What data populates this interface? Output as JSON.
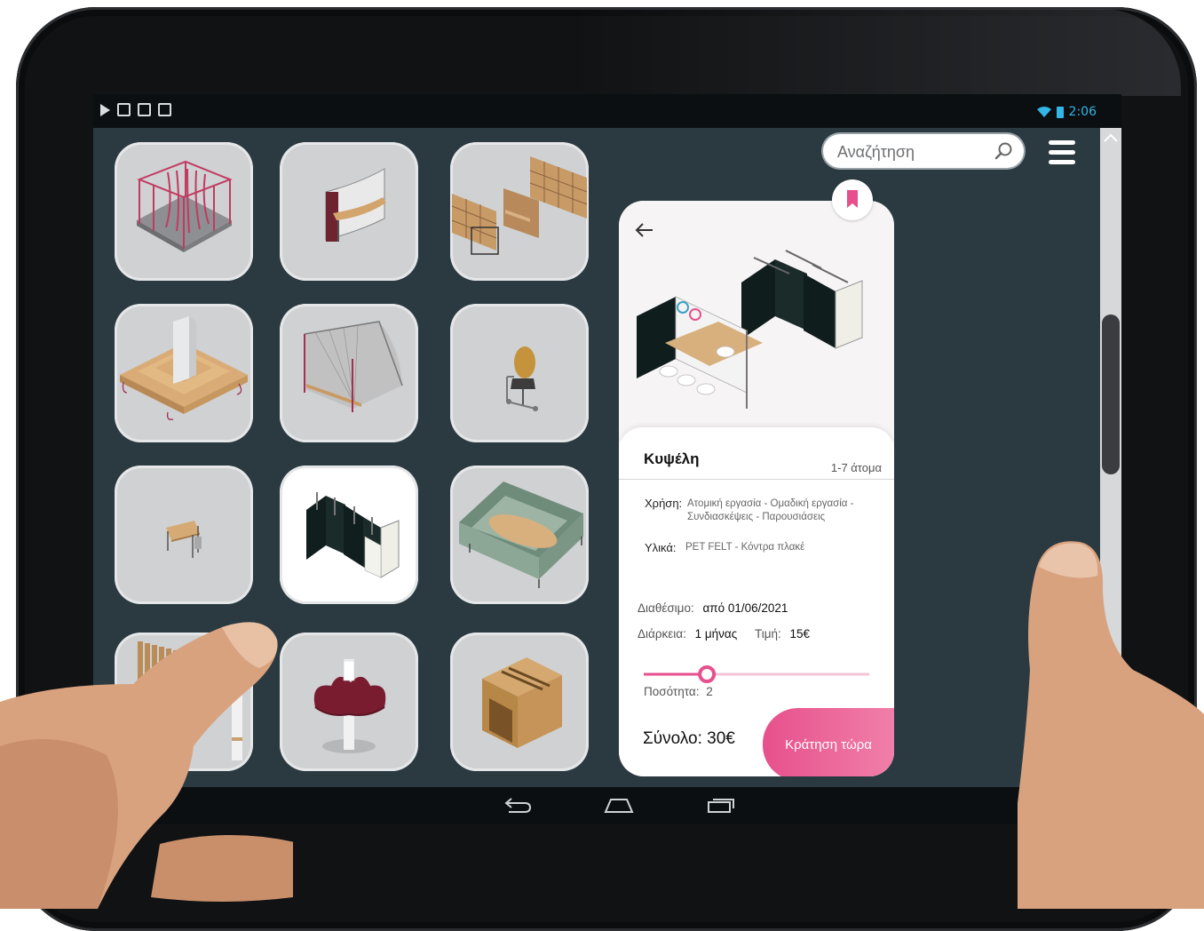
{
  "statusbar": {
    "time": "2:06"
  },
  "search": {
    "placeholder": "Αναζήτηση"
  },
  "colors": {
    "background": "#2a3a40",
    "accent": "#e7508c",
    "tile": "#cfd1d3"
  },
  "products": [
    {
      "icon": "canopy-pavilion-icon"
    },
    {
      "icon": "curved-desk-icon"
    },
    {
      "icon": "shelving-workspace-icon"
    },
    {
      "icon": "tiered-platform-icon"
    },
    {
      "icon": "shelter-bench-icon"
    },
    {
      "icon": "pod-chair-icon"
    },
    {
      "icon": "small-desk-icon"
    },
    {
      "icon": "cubicle-booths-icon",
      "selected": true
    },
    {
      "icon": "lounge-meeting-icon"
    },
    {
      "icon": "slatted-screen-icon"
    },
    {
      "icon": "cloud-canopy-icon"
    },
    {
      "icon": "timber-pod-icon"
    }
  ],
  "detail": {
    "title": "Κυψέλη",
    "people": "1-7 άτομα",
    "use_label": "Χρήση:",
    "use_value": "Ατομική εργασία - Ομαδική εργασία - Συνδιασκέψεις - Παρουσιάσεις",
    "materials_label": "Υλικά:",
    "materials_value": "PET FELT - Κόντρα πλακέ",
    "available_label": "Διαθέσιμο:",
    "available_value": "από 01/06/2021",
    "duration_label": "Διάρκεια:",
    "duration_value": "1 μήνας",
    "price_label": "Τιμή:",
    "price_value": "15€",
    "quantity_label": "Ποσότητα:",
    "quantity_value": "2",
    "quantity_slider_fraction": 0.28,
    "total": "Σύνολο: 30€",
    "book_button": "Κράτηση τώρα"
  }
}
